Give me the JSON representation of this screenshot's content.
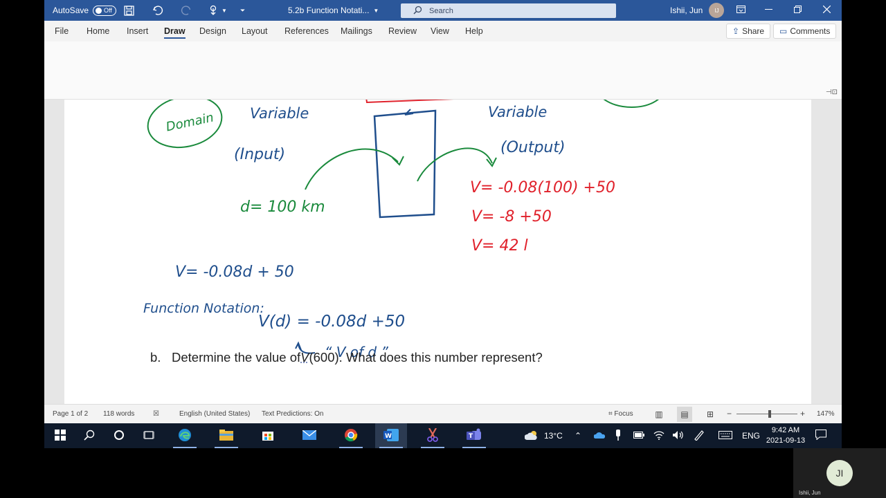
{
  "titlebar": {
    "autosave_label": "AutoSave",
    "autosave_state": "Off",
    "document_title": "5.2b Function Notati...",
    "search_placeholder": "Search",
    "user_name": "Ishii, Jun",
    "user_initials": "IJ"
  },
  "ribbon": {
    "tabs": [
      "File",
      "Home",
      "Insert",
      "Draw",
      "Design",
      "Layout",
      "References",
      "Mailings",
      "Review",
      "View",
      "Help"
    ],
    "active_tab": "Draw",
    "share_label": "Share",
    "comments_label": "Comments"
  },
  "document": {
    "handwriting": {
      "input_var_label": "Variable",
      "output_var_label": "Variable",
      "domain": "Domain",
      "input": "(Input)",
      "output": "(Output)",
      "input_value": "d= 100 km",
      "calc_line1": "V= -0.08(100) +50",
      "calc_line2": "V=  -8  +50",
      "calc_line3": "V= 42 l",
      "equation": "V= -0.08d + 50",
      "notation_title": "Function Notation:",
      "notation_eq": "V(d) = -0.08d +50",
      "notation_read": "“ V of d ”"
    },
    "question": {
      "label": "b.",
      "prefix": "Determine the value of ",
      "var": "V",
      "suffix": "(600). What does this number represent?"
    },
    "colors": {
      "blue_ink": "#1f4e8c",
      "green_ink": "#1a8a3c",
      "red_ink": "#e0202a"
    }
  },
  "statusbar": {
    "page": "Page 1 of 2",
    "words": "118 words",
    "language": "English (United States)",
    "text_predictions": "Text Predictions: On",
    "focus": "Focus",
    "zoom": "147%"
  },
  "taskbar": {
    "weather": "13°C",
    "language": "ENG",
    "time": "9:42 AM",
    "date": "2021-09-13"
  },
  "webcam": {
    "initials": "JI",
    "name": "Ishii, Jun"
  }
}
